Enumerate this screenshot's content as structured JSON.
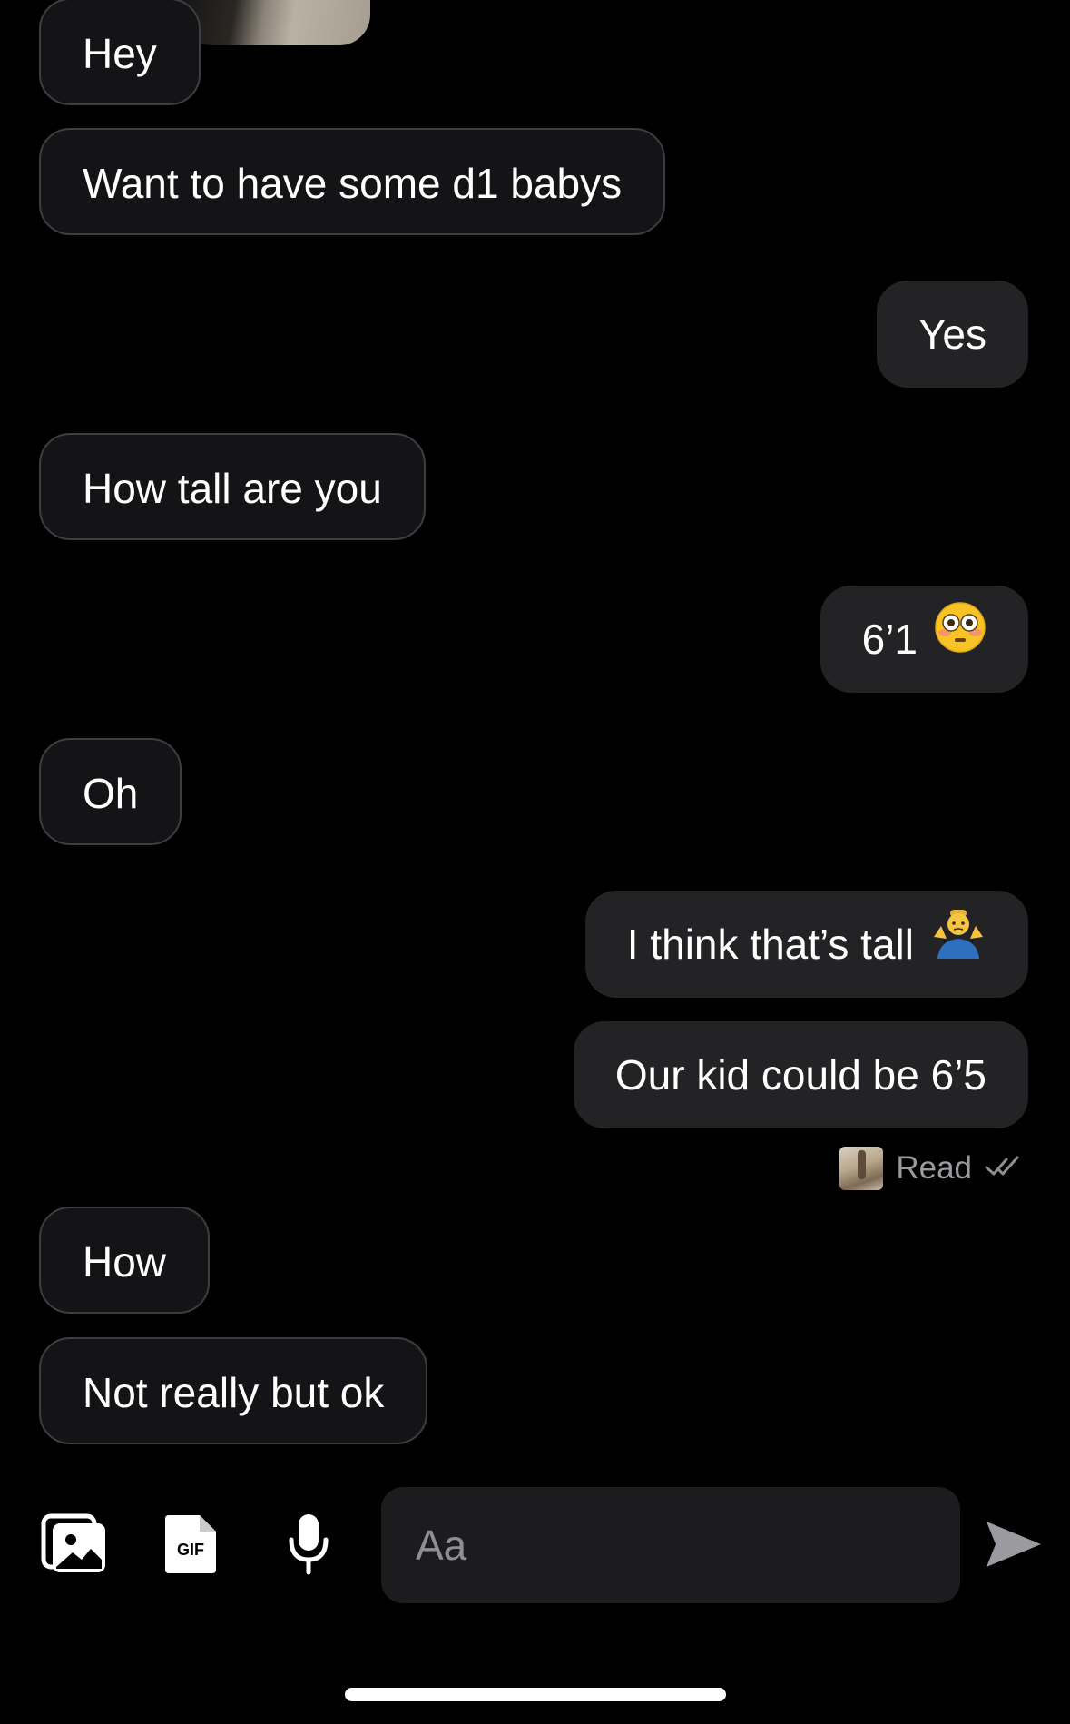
{
  "messages": [
    {
      "side": "in",
      "text": "Hey"
    },
    {
      "side": "in",
      "text": "Want to have some d1 babys"
    },
    {
      "side": "out",
      "text": "Yes"
    },
    {
      "side": "in",
      "text": "How tall are you"
    },
    {
      "side": "out",
      "text": "6’1",
      "emoji": "flushed-face-emoji"
    },
    {
      "side": "in",
      "text": "Oh"
    },
    {
      "side": "out",
      "text": "I think that’s tall",
      "emoji": "person-shrugging-emoji"
    },
    {
      "side": "out",
      "text": "Our kid could be 6’5"
    },
    {
      "side": "in",
      "text": "How"
    },
    {
      "side": "in",
      "text": "Not really but ok"
    }
  ],
  "read_receipt": {
    "label": "Read",
    "icon": "double-check-icon"
  },
  "composer": {
    "placeholder": "Aa",
    "tools": [
      "gallery-icon",
      "gif-icon",
      "microphone-icon"
    ],
    "send_icon": "send-icon"
  },
  "colors": {
    "background": "#000000",
    "bubble_in": "#141416",
    "bubble_out": "#232325",
    "muted_text": "#9a9a9f"
  }
}
